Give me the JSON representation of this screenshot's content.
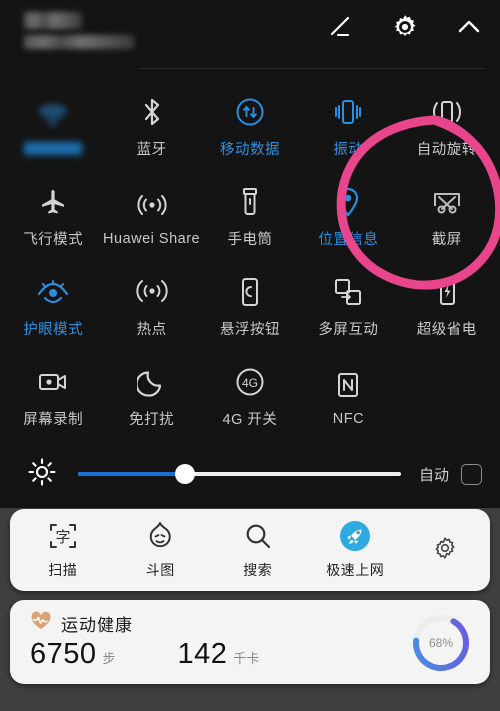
{
  "header": {
    "blurred_carrier": "",
    "blurred_date": "",
    "icons": [
      {
        "name": "edit-icon",
        "label": "编辑"
      },
      {
        "name": "gear-icon",
        "label": "设置"
      },
      {
        "name": "chevron-up-icon",
        "label": "收起"
      }
    ]
  },
  "toggles": [
    {
      "label": "WLAN",
      "icon": "wifi-icon",
      "state": "on",
      "blurred": true
    },
    {
      "label": "蓝牙",
      "icon": "bluetooth-icon",
      "state": "off",
      "blurred": false
    },
    {
      "label": "移动数据",
      "icon": "mobile-data-icon",
      "state": "on",
      "blurred": false
    },
    {
      "label": "振动",
      "icon": "vibrate-icon",
      "state": "on",
      "blurred": false
    },
    {
      "label": "自动旋转",
      "icon": "auto-rotate-icon",
      "state": "off",
      "blurred": false
    },
    {
      "label": "飞行模式",
      "icon": "airplane-icon",
      "state": "off",
      "blurred": false
    },
    {
      "label": "Huawei Share",
      "icon": "huawei-share-icon",
      "state": "off",
      "blurred": false
    },
    {
      "label": "手电筒",
      "icon": "flashlight-icon",
      "state": "off",
      "blurred": false
    },
    {
      "label": "位置信息",
      "icon": "location-pin-icon",
      "state": "on",
      "blurred": false
    },
    {
      "label": "截屏",
      "icon": "screenshot-icon",
      "state": "off",
      "blurred": false
    },
    {
      "label": "护眼模式",
      "icon": "eye-comfort-icon",
      "state": "on",
      "blurred": false
    },
    {
      "label": "热点",
      "icon": "hotspot-icon",
      "state": "off",
      "blurred": false
    },
    {
      "label": "悬浮按钮",
      "icon": "floating-button-icon",
      "state": "off",
      "blurred": false
    },
    {
      "label": "多屏互动",
      "icon": "mirror-share-icon",
      "state": "off",
      "blurred": false
    },
    {
      "label": "超级省电",
      "icon": "ultra-power-save-icon",
      "state": "off",
      "blurred": false
    },
    {
      "label": "屏幕录制",
      "icon": "screen-record-icon",
      "state": "off",
      "blurred": false
    },
    {
      "label": "免打扰",
      "icon": "do-not-disturb-icon",
      "state": "off",
      "blurred": false
    },
    {
      "label": "4G 开关",
      "icon": "four-g-icon",
      "state": "off",
      "blurred": false
    },
    {
      "label": "NFC",
      "icon": "nfc-icon",
      "state": "off",
      "blurred": false
    },
    {
      "label": "",
      "icon": "",
      "state": "empty",
      "blurred": false
    }
  ],
  "brightness": {
    "icon": "brightness-sun-icon",
    "value_percent": 33,
    "auto_label": "自动",
    "auto_checked": false
  },
  "shortcuts": [
    {
      "label": "扫描",
      "icon": "scan-text-icon"
    },
    {
      "label": "斗图",
      "icon": "meme-face-icon"
    },
    {
      "label": "搜索",
      "icon": "search-icon"
    },
    {
      "label": "极速上网",
      "icon": "rocket-icon"
    }
  ],
  "shortcuts_settings_icon": "gear-icon",
  "health": {
    "title": "运动健康",
    "heart_icon": "heart-pulse-icon",
    "steps_value": "6750",
    "steps_unit": "步",
    "calories_value": "142",
    "calories_unit": "千卡",
    "ring_label": "68%",
    "ring_percent": 68
  },
  "annotation": {
    "type": "hand-drawn-circle",
    "target": "截屏",
    "color": "#e8458c"
  },
  "colors": {
    "panel_bg": "#141414",
    "page_bg": "#3f3f3f",
    "accent_on": "#2b8fe0",
    "label_off": "#c9c9c9",
    "card_bg": "#f4f4f4",
    "annotation_pink": "#e8458c",
    "ring_start": "#4a90e2",
    "ring_end": "#6a5ae0",
    "heart_tan": "#d9a577",
    "rocket_blue": "#2eaae0"
  }
}
